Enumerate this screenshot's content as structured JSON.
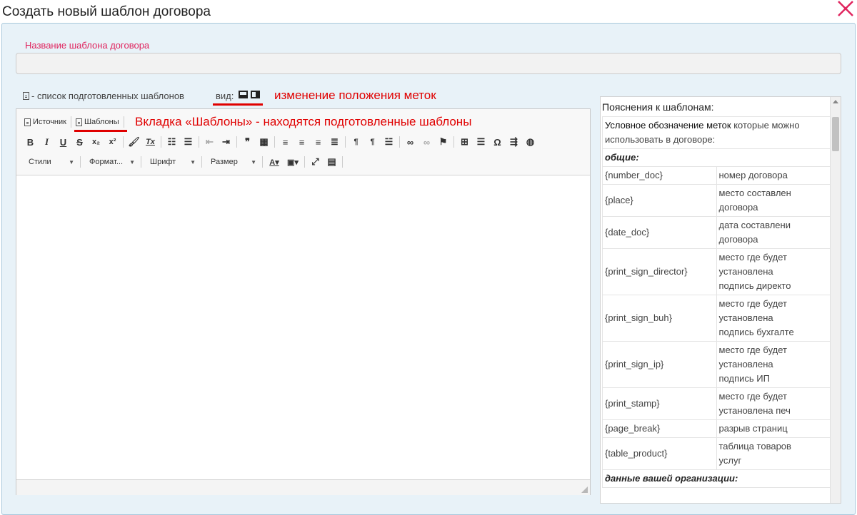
{
  "dialog": {
    "title": "Создать новый шаблон договора",
    "close_icon": "close-x-icon",
    "accent_color": "#e0245e",
    "annotation_color": "#e00000"
  },
  "form": {
    "name_label": "Название шаблона договора",
    "name_value": "",
    "templates_hint": "- список подготовленных шаблонов",
    "view_label": "вид:"
  },
  "annotations": {
    "view_note": "изменение положения меток",
    "templates_note": "Вкладка «Шаблоны» - находятся подготовленные шаблоны"
  },
  "editor": {
    "tabs": [
      "Источник",
      "Шаблоны"
    ],
    "buttons": {
      "bold": "B",
      "italic": "I",
      "underline": "U",
      "strike": "S",
      "subscript": "x₂",
      "superscript": "x²",
      "remove_format": "Tx",
      "blockquote": "❞",
      "omega": "Ω"
    },
    "combos": {
      "styles": "Стили",
      "format": "Формат...",
      "font": "Шрифт",
      "size": "Размер"
    }
  },
  "sidebar": {
    "title": "Пояснения к шаблонам:",
    "intro_bold": "Условное обозначение меток",
    "intro_rest": " которые можно использовать в договоре:",
    "section_general": "общие:",
    "rows": [
      {
        "tag": "{number_doc}",
        "desc": "номер договора"
      },
      {
        "tag": "{place}",
        "desc": "место составлен\nдоговора"
      },
      {
        "tag": "{date_doc}",
        "desc": "дата составлени\nдоговора"
      },
      {
        "tag": "{print_sign_director}",
        "desc": "место где будет\nустановлена\nподпись директо"
      },
      {
        "tag": "{print_sign_buh}",
        "desc": "место где будет\nустановлена\nподпись бухгалте"
      },
      {
        "tag": "{print_sign_ip}",
        "desc": "место где будет\nустановлена\nподпись ИП"
      },
      {
        "tag": "{print_stamp}",
        "desc": "место где будет\nустановлена печ"
      },
      {
        "tag": "{page_break}",
        "desc": "разрыв страниц"
      },
      {
        "tag": "{table_product}",
        "desc": "таблица товаров\nуслуг"
      }
    ],
    "section_org": "данные вашей организации:"
  }
}
